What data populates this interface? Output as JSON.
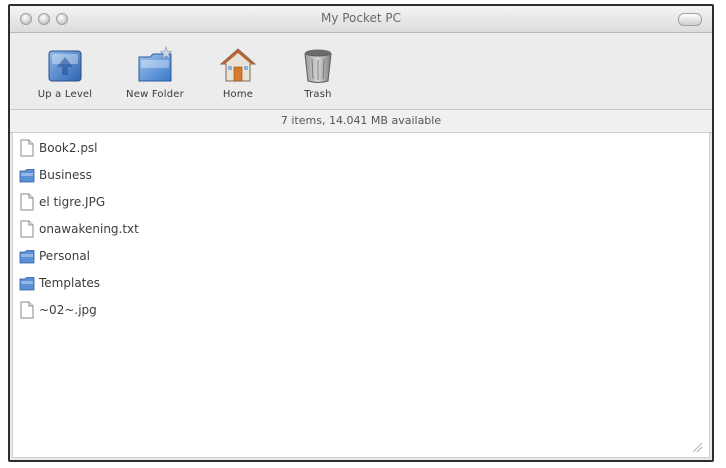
{
  "window": {
    "title": "My Pocket PC"
  },
  "toolbar": {
    "buttons": [
      {
        "label": "Up a Level",
        "icon": "up-level-icon"
      },
      {
        "label": "New Folder",
        "icon": "new-folder-icon"
      },
      {
        "label": "Home",
        "icon": "home-icon"
      },
      {
        "label": "Trash",
        "icon": "trash-icon"
      }
    ]
  },
  "status": {
    "text": "7 items, 14.041 MB available"
  },
  "files": [
    {
      "name": "Book2.psl",
      "type": "document"
    },
    {
      "name": "Business",
      "type": "folder"
    },
    {
      "name": "el tigre.JPG",
      "type": "document"
    },
    {
      "name": "onawakening.txt",
      "type": "document"
    },
    {
      "name": "Personal",
      "type": "folder"
    },
    {
      "name": "Templates",
      "type": "folder"
    },
    {
      "name": "~02~.jpg",
      "type": "document"
    }
  ],
  "colors": {
    "accent": "#3a78c9",
    "folder": "#5b8fd6",
    "background": "#e9e9e9"
  }
}
